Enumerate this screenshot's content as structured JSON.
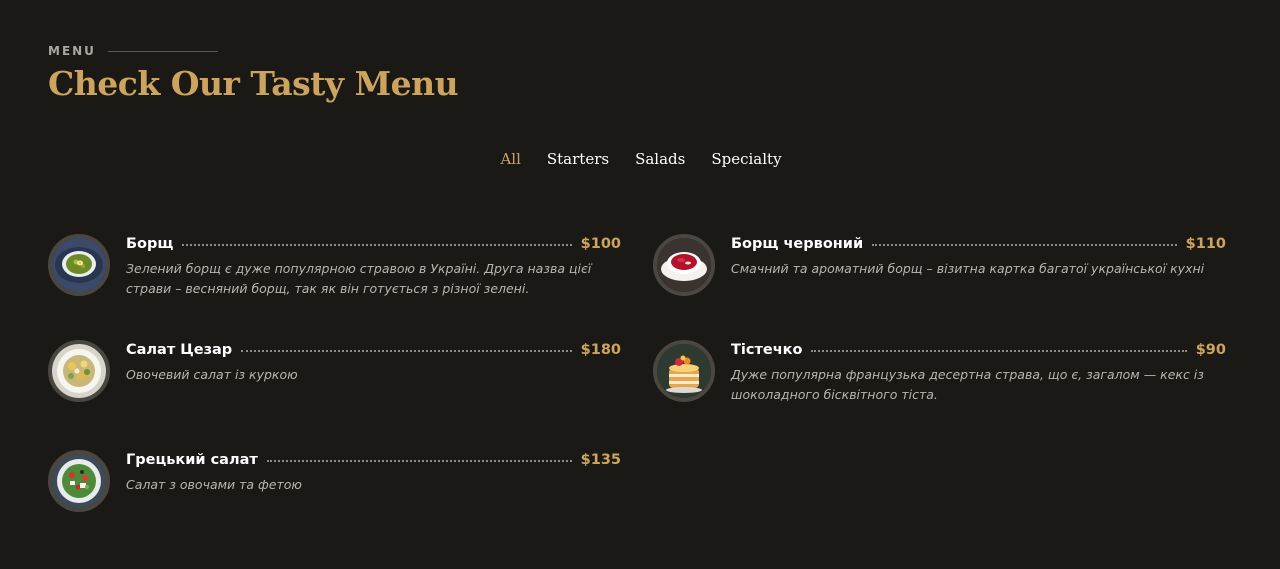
{
  "section": {
    "eyebrow": "MENU",
    "title": "Check Our Tasty Menu"
  },
  "filters": [
    {
      "label": "All",
      "active": true
    },
    {
      "label": "Starters",
      "active": false
    },
    {
      "label": "Salads",
      "active": false
    },
    {
      "label": "Specialty",
      "active": false
    }
  ],
  "items": [
    {
      "name": "Борщ",
      "price": "$100",
      "description": "Зелений борщ є дуже популярною стравою в Україні. Друга назва цієї страви – весняний борщ, так як він готується з різної зелені.",
      "image": "green-borscht-image"
    },
    {
      "name": "Борщ червоний",
      "price": "$110",
      "description": "Смачний та ароматний борщ – візитна картка багатої української кухні",
      "image": "red-borscht-image"
    },
    {
      "name": "Салат Цезар",
      "price": "$180",
      "description": "Овочевий салат із куркою",
      "image": "caesar-salad-image"
    },
    {
      "name": "Тістечко",
      "price": "$90",
      "description": "Дуже популярна французька десертна страва, що є, загалом — кекс із шоколадного бісквітного тіста.",
      "image": "cake-image"
    },
    {
      "name": "Грецький салат",
      "price": "$135",
      "description": "Салат з овочами та фетою",
      "image": "greek-salad-image"
    }
  ],
  "colors": {
    "background": "#1b1916",
    "accent": "#cda45e",
    "text": "#ffffff",
    "muted": "#b9b5ae"
  }
}
